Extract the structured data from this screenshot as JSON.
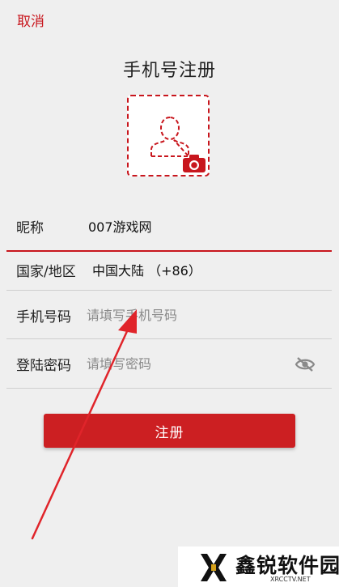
{
  "header": {
    "cancel_label": "取消",
    "title": "手机号注册"
  },
  "avatar": {
    "placeholder_icon": "person-outline-icon",
    "upload_icon": "camera-icon"
  },
  "form": {
    "nickname": {
      "label": "昵称",
      "value": "007游戏网"
    },
    "region": {
      "label": "国家/地区",
      "value": "中国大陆 （+86）"
    },
    "phone": {
      "label": "手机号码",
      "placeholder": "请填写手机号码",
      "value": ""
    },
    "password": {
      "label": "登陆密码",
      "placeholder": "请填写密码",
      "value": "",
      "toggle_icon": "eye-hidden-icon"
    }
  },
  "submit_label": "注册",
  "watermark": {
    "text": "鑫锐软件园",
    "sub": "XRCCTV.NET"
  },
  "colors": {
    "accent": "#c8161d",
    "background": "#efefef",
    "divider": "#cfcfcf"
  }
}
